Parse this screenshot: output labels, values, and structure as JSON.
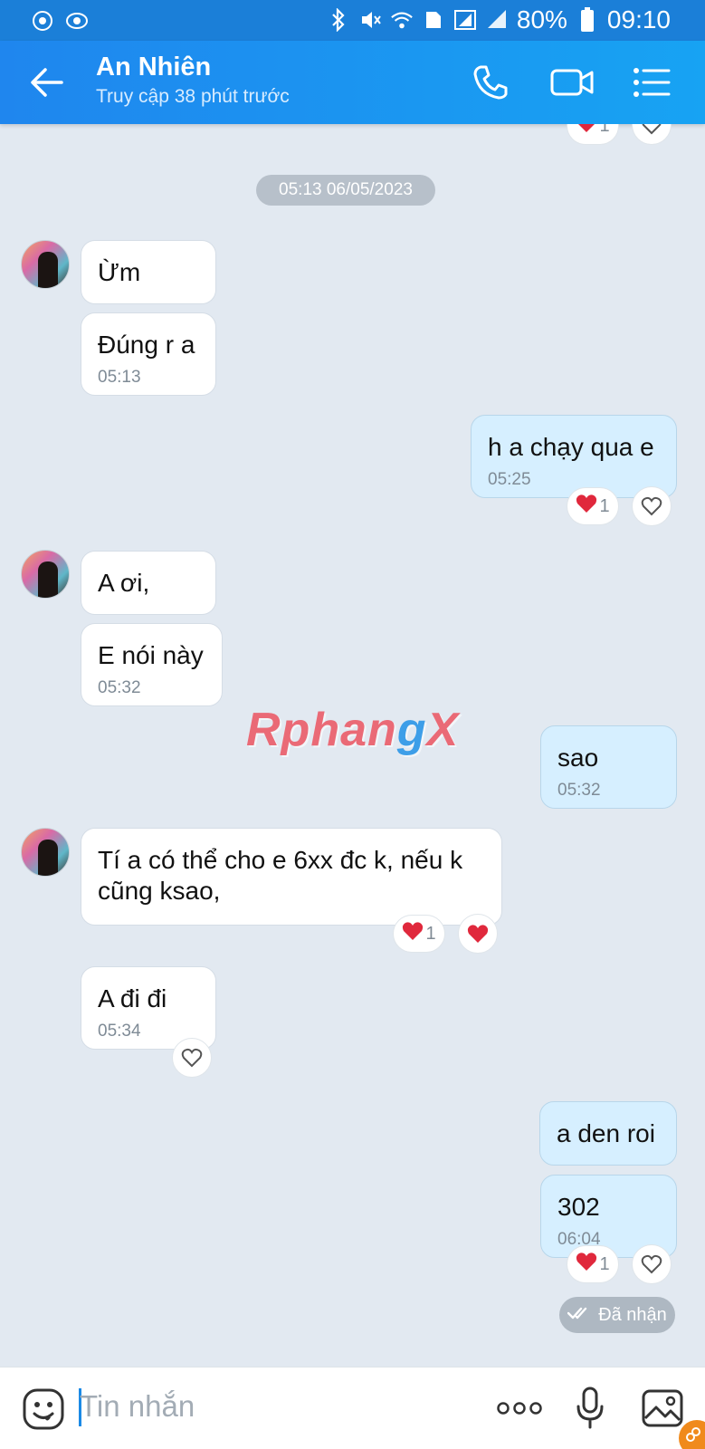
{
  "status_bar": {
    "battery": "80%",
    "time": "09:10"
  },
  "header": {
    "contact_name": "An Nhiên",
    "last_seen": "Truy cập 38 phút trước"
  },
  "chat": {
    "date_separator": "05:13 06/05/2023",
    "top_reaction_count": "1",
    "messages": [
      {
        "side": "left",
        "text": "Ừm",
        "time": ""
      },
      {
        "side": "left",
        "text": "Đúng r a",
        "time": "05:13"
      },
      {
        "side": "right",
        "text": "h a chạy qua e",
        "time": "05:25",
        "reaction_count": "1"
      },
      {
        "side": "left",
        "text": "A ơi,",
        "time": ""
      },
      {
        "side": "left",
        "text": "E nói này",
        "time": "05:32"
      },
      {
        "side": "right",
        "text": "sao",
        "time": "05:32"
      },
      {
        "side": "left",
        "text": "Tí a có thể cho e 6xx đc k, nếu k cũng ksao,",
        "time": "",
        "reaction_count": "1"
      },
      {
        "side": "left",
        "text": "A đi đi",
        "time": "05:34"
      },
      {
        "side": "right",
        "text": "a den roi",
        "time": ""
      },
      {
        "side": "right",
        "text": "302",
        "time": "06:04",
        "reaction_count": "1"
      }
    ],
    "delivery_status": "Đã nhận"
  },
  "watermark": {
    "part1": "Rphan",
    "part2": "g",
    "part3": "X"
  },
  "input": {
    "placeholder": "Tin nhắn"
  },
  "colors": {
    "header_start": "#1f86ee",
    "header_end": "#17a3f3",
    "chat_bg": "#e2e9f1",
    "my_bubble": "#d6efff",
    "heart": "#e0283c"
  }
}
